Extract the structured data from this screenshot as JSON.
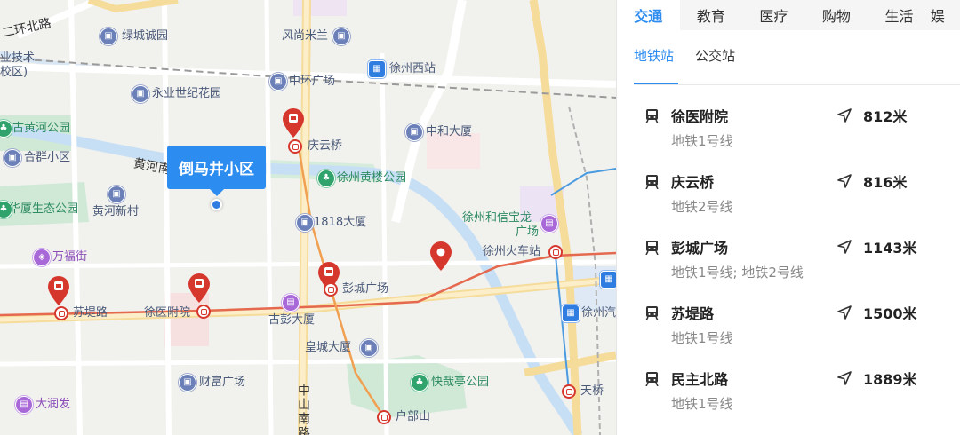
{
  "map": {
    "selected_place": "倒马井小区",
    "labels": {
      "erhuan_north_road": "二环北路",
      "vocational": "业技术",
      "campus": "校区)",
      "lvcheng_garden": "绿城诚园",
      "fengshang_milan": "风尚米兰",
      "zhonghuan_square": "中环广场",
      "xuzhou_west_station": "徐州西站",
      "yongye_garden": "永业世纪花园",
      "old_yellow_river_park": "古黄河公园",
      "qingyunqiao": "庆云桥",
      "zhonghe_building": "中和大厦",
      "hequn_community": "合群小区",
      "huanghe_south": "黄河南",
      "huanglou_park": "徐州黄楼公园",
      "huaxia_eco_park": "华厦生态公园",
      "huanghe_new_village": "黄河新村",
      "building_1818": "1818大厦",
      "hexinbaolong_1": "徐州和信宝龙",
      "hexinbaolong_2": "广场",
      "wanfu_street": "万福街",
      "xuzhou_railway_station": "徐州火车站",
      "pengcheng_square": "彭城广场",
      "sudi_road": "苏堤路",
      "xuyi_fuyuan": "徐医附院",
      "gupeng_building": "古彭大厦",
      "xuzhou_auto": "徐州汽",
      "huangcheng_building": "皇城大厦",
      "caifu_square": "财富广场",
      "kuaizaiting_park": "快哉亭公园",
      "zhongshan_south_road": "中山南路",
      "tianqiao": "天桥",
      "hubushan": "户部山",
      "darunfa": "大润发"
    }
  },
  "panel": {
    "category_tabs": [
      "交通",
      "教育",
      "医疗",
      "购物",
      "生活",
      "娱"
    ],
    "active_category": "交通",
    "sub_tabs": [
      "地铁站",
      "公交站"
    ],
    "active_sub_tab": "地铁站",
    "stations": [
      {
        "name": "徐医附院",
        "lines": "地铁1号线",
        "distance": "812米"
      },
      {
        "name": "庆云桥",
        "lines": "地铁2号线",
        "distance": "816米"
      },
      {
        "name": "彭城广场",
        "lines": "地铁1号线; 地铁2号线",
        "distance": "1143米"
      },
      {
        "name": "苏堤路",
        "lines": "地铁1号线",
        "distance": "1500米"
      },
      {
        "name": "民主北路",
        "lines": "地铁1号线",
        "distance": "1889米"
      }
    ]
  },
  "colors": {
    "accent": "#2d8cf0",
    "metro_red": "#d6372d",
    "green_area": "#c9e8d2",
    "water": "#c7dff5"
  }
}
